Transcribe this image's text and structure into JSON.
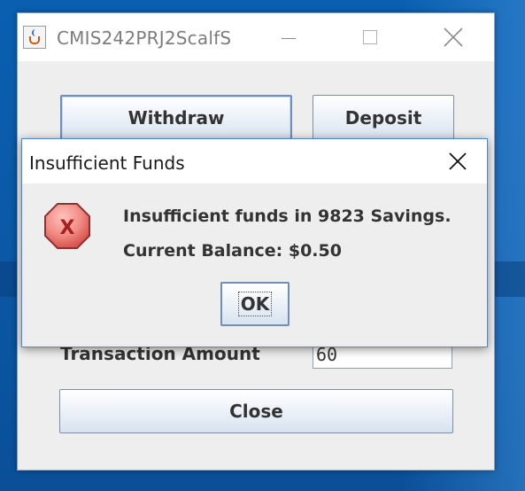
{
  "main_window": {
    "title": "CMIS242PRJ2ScalfS",
    "buttons": {
      "withdraw": "Withdraw",
      "deposit": "Deposit",
      "close": "Close"
    },
    "transaction_amount": {
      "label": "Transaction Amount",
      "value": "60"
    }
  },
  "dialog": {
    "title": "Insufficient Funds",
    "icon": "error-icon",
    "message_line1": "Insufficient funds in 9823 Savings.",
    "message_line2": "Current Balance: $0.50",
    "ok_label": "OK"
  },
  "colors": {
    "desktop_blue": "#0b5aa9",
    "dialog_border": "#4a8ad4",
    "error_red": "#d9534f"
  }
}
